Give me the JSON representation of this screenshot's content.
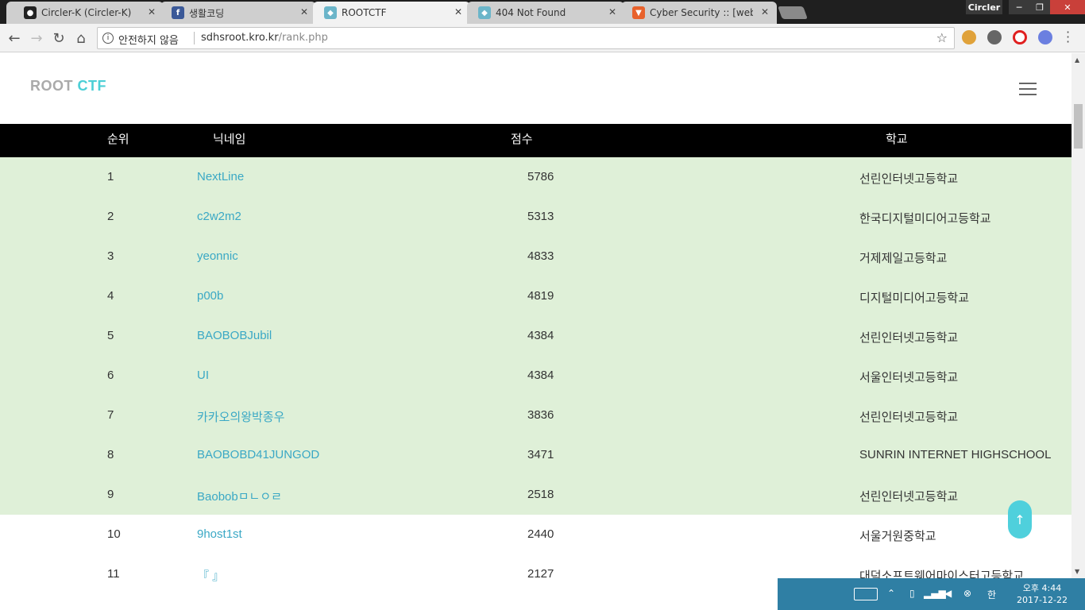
{
  "browser": {
    "tabs": [
      {
        "title": "Circler-K (Circler-K)",
        "icon": "github-icon",
        "active": false
      },
      {
        "title": "생활코딩",
        "icon": "facebook-icon",
        "active": false
      },
      {
        "title": "ROOTCTF",
        "icon": "rootctf-icon",
        "active": true
      },
      {
        "title": "404 Not Found",
        "icon": "rootctf-icon",
        "active": false
      },
      {
        "title": "Cyber Security :: [webha",
        "icon": "brave-icon",
        "active": false
      }
    ],
    "profile_name": "Circler",
    "security_label": "안전하지 않음",
    "url_host": "sdhsroot.kro.kr",
    "url_path": "/rank.php"
  },
  "site": {
    "brand_root": "ROOT",
    "brand_ctf": "CTF"
  },
  "table": {
    "headers": {
      "rank": "순위",
      "nickname": "닉네임",
      "score": "점수",
      "school": "학교"
    },
    "rows": [
      {
        "rank": "1",
        "nickname": "NextLine",
        "score": "5786",
        "school": "선린인터넷고등학교"
      },
      {
        "rank": "2",
        "nickname": "c2w2m2",
        "score": "5313",
        "school": "한국디지털미디어고등학교"
      },
      {
        "rank": "3",
        "nickname": "yeonnic",
        "score": "4833",
        "school": "거제제일고등학교"
      },
      {
        "rank": "4",
        "nickname": "p00b",
        "score": "4819",
        "school": "디지털미디어고등학교"
      },
      {
        "rank": "5",
        "nickname": "BAOBOBJubil",
        "score": "4384",
        "school": "선린인터넷고등학교"
      },
      {
        "rank": "6",
        "nickname": "UI",
        "score": "4384",
        "school": "서울인터넷고등학교"
      },
      {
        "rank": "7",
        "nickname": "카카오의왕박종우",
        "score": "3836",
        "school": "선린인터넷고등학교"
      },
      {
        "rank": "8",
        "nickname": "BAOBOBD41JUNGOD",
        "score": "3471",
        "school": "SUNRIN INTERNET HIGHSCHOOL"
      },
      {
        "rank": "9",
        "nickname": "Baobobㅁㄴㅇㄹ",
        "score": "2518",
        "school": "선린인터넷고등학교"
      },
      {
        "rank": "10",
        "nickname": "9host1st",
        "score": "2440",
        "school": "서울거원중학교"
      },
      {
        "rank": "11",
        "nickname": "『 』",
        "score": "2127",
        "school": "대덕소프트웨어마이스터고등학교"
      }
    ]
  },
  "taskbar": {
    "ime": "한",
    "time": "오후 4:44",
    "date": "2017-12-22"
  }
}
